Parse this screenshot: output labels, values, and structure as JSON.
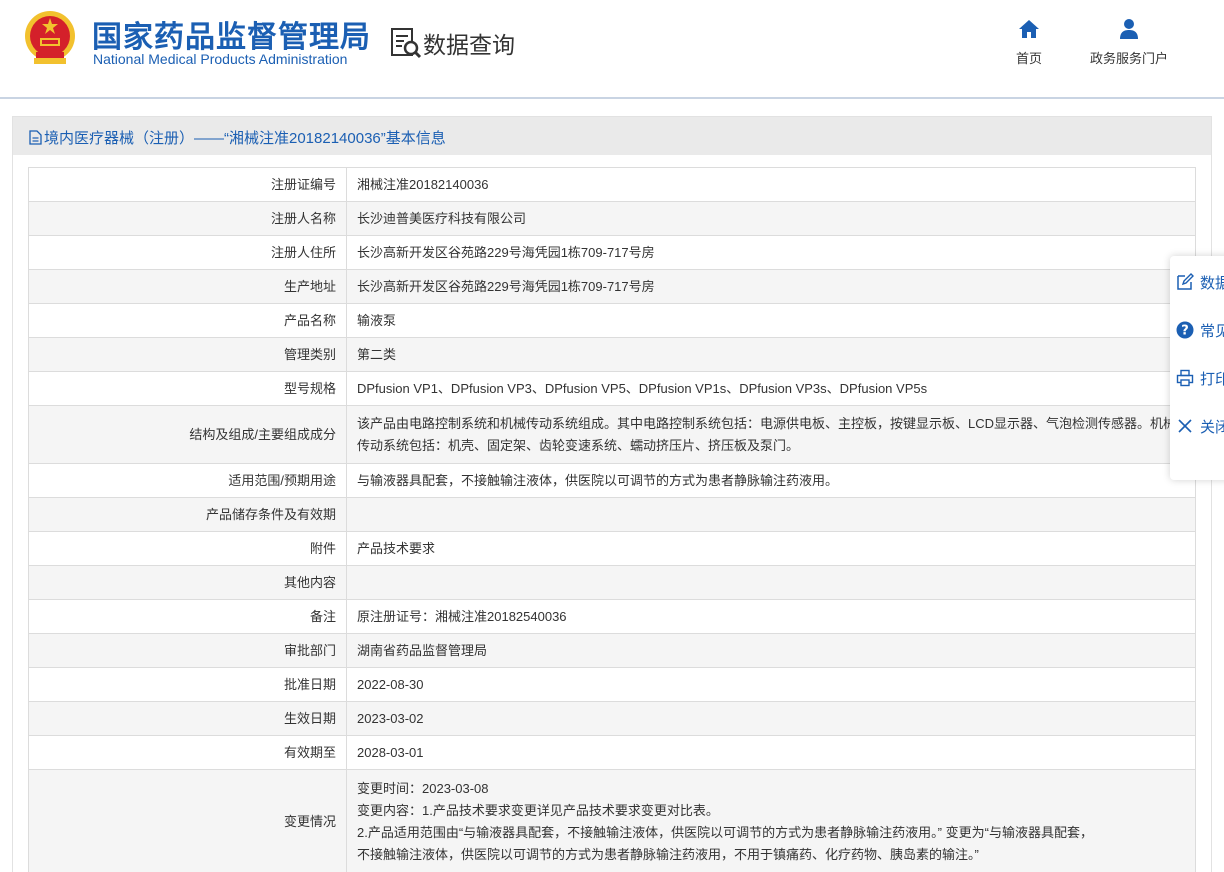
{
  "header": {
    "brand_cn": "国家药品监督管理局",
    "brand_en": "National Medical Products Administration",
    "section_title": "数据查询",
    "nav": [
      {
        "label": "首页",
        "icon": "home-icon"
      },
      {
        "label": "政务服务门户",
        "icon": "user-icon"
      }
    ]
  },
  "colors": {
    "brand_blue": "#1b5fb3",
    "header_bar": "#eaeaea",
    "row_alt": "#f5f5f5",
    "emblem_red": "#d4202a",
    "emblem_gold": "#f2c12e"
  },
  "panel": {
    "title": "境内医疗器械（注册）——“湘械注准20182140036”基本信息"
  },
  "rows": [
    {
      "key": "注册证编号",
      "value": "湘械注准20182140036"
    },
    {
      "key": "注册人名称",
      "value": "长沙迪普美医疗科技有限公司"
    },
    {
      "key": "注册人住所",
      "value": "长沙高新开发区谷苑路229号海凭园1栋709-717号房"
    },
    {
      "key": "生产地址",
      "value": "长沙高新开发区谷苑路229号海凭园1栋709-717号房"
    },
    {
      "key": "产品名称",
      "value": "输液泵"
    },
    {
      "key": "管理类别",
      "value": "第二类"
    },
    {
      "key": "型号规格",
      "value": "DPfusion VP1、DPfusion VP3、DPfusion VP5、DPfusion VP1s、DPfusion VP3s、DPfusion VP5s"
    },
    {
      "key": "结构及组成/主要组成成分",
      "value": "该产品由电路控制系统和机械传动系统组成。其中电路控制系统包括：电源供电板、主控板，按键显示板、LCD显示器、气泡检测传感器。机械传动系统包括：机壳、固定架、齿轮变速系统、蠕动挤压片、挤压板及泵门。"
    },
    {
      "key": "适用范围/预期用途",
      "value": "与输液器具配套，不接触输注液体，供医院以可调节的方式为患者静脉输注药液用。"
    },
    {
      "key": "产品储存条件及有效期",
      "value": ""
    },
    {
      "key": "附件",
      "value": "产品技术要求"
    },
    {
      "key": "其他内容",
      "value": ""
    },
    {
      "key": "备注",
      "value": "原注册证号：湘械注准20182540036"
    },
    {
      "key": "审批部门",
      "value": "湖南省药品监督管理局"
    },
    {
      "key": "批准日期",
      "value": "2022-08-30"
    },
    {
      "key": "生效日期",
      "value": "2023-03-02"
    },
    {
      "key": "有效期至",
      "value": "2028-03-01"
    }
  ],
  "change": {
    "key": "变更情况",
    "lines": [
      "变更时间：2023-03-08",
      "变更内容：1.产品技术要求变更详见产品技术要求变更对比表。",
      "2.产品适用范围由“与输液器具配套，不接触输注液体，供医院以可调节的方式为患者静脉输注药液用。” 变更为“与输液器具配套，",
      "不接触输注液体，供医院以可调节的方式为患者静脉输注药液用，不用于镇痛药、化疗药物、胰岛素的输注。”"
    ]
  },
  "side_tools": [
    {
      "label": "数据",
      "icon": "edit-icon"
    },
    {
      "label": "常见",
      "icon": "help-icon"
    },
    {
      "label": "打印",
      "icon": "print-icon"
    },
    {
      "label": "关闭",
      "icon": "close-icon"
    }
  ]
}
